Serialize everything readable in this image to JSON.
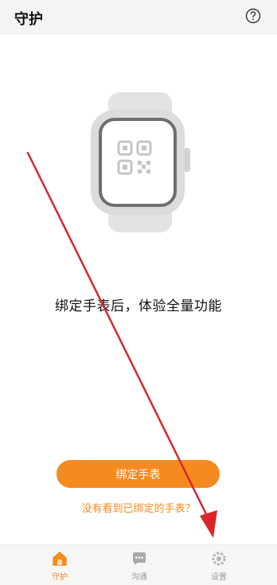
{
  "header": {
    "title": "守护",
    "help_icon": "help-circle-icon"
  },
  "main": {
    "illustration": "smartwatch-qr-icon",
    "tagline": "绑定手表后，体验全量功能",
    "bind_button": "绑定手表",
    "not_found_link": "没有看到已绑定的手表？"
  },
  "tabbar": {
    "items": [
      {
        "label": "守护",
        "icon": "home-icon",
        "active": true
      },
      {
        "label": "沟通",
        "icon": "chat-bubble-icon",
        "active": false
      },
      {
        "label": "设置",
        "icon": "settings-icon",
        "active": false
      }
    ]
  },
  "annotation": {
    "arrow_color": "#d9262a"
  },
  "colors": {
    "accent": "#f58a1f",
    "inactive": "#9a9a9a",
    "header_bg": "#f4f4f4"
  }
}
